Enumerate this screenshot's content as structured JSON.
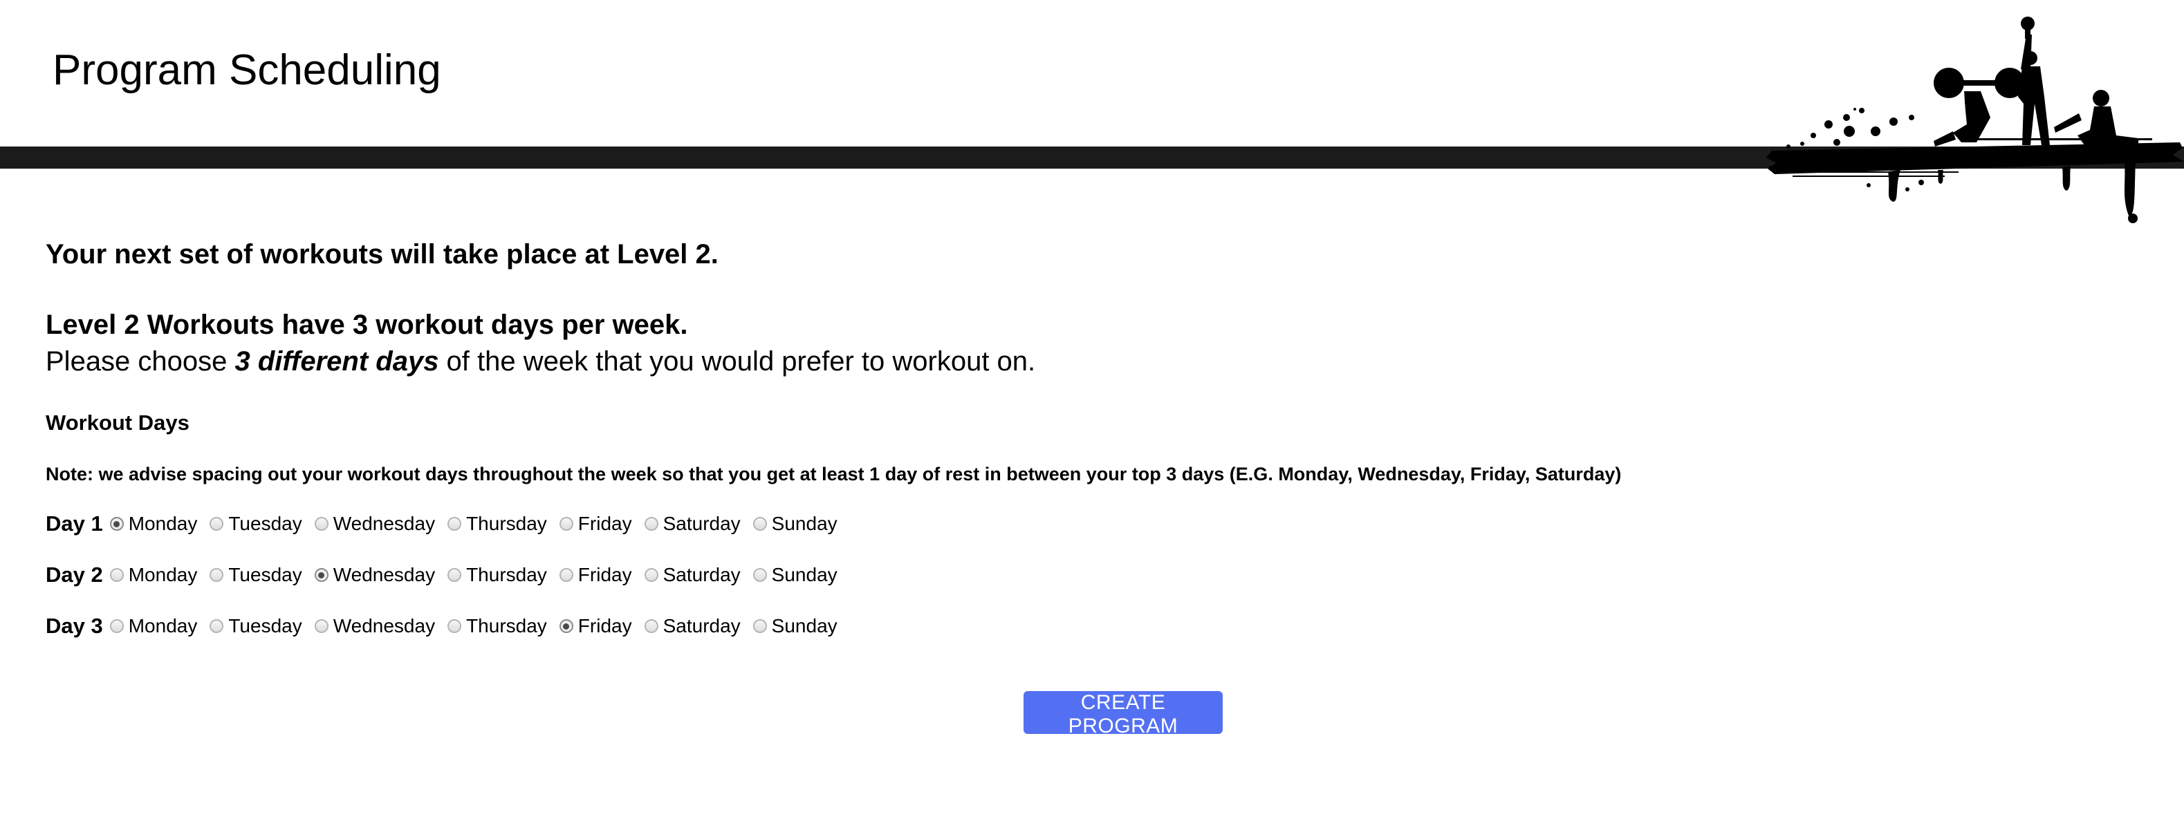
{
  "header": {
    "title": "Program Scheduling",
    "logo_icon": "fitness-athletes-silhouette-icon"
  },
  "intro": {
    "next_level_text": "Your next set of workouts will take place at Level 2.",
    "level_workouts_text": "Level 2 Workouts have 3 workout days per week.",
    "choose_prefix": "Please choose ",
    "choose_emphasis": "3 different days",
    "choose_suffix": " of the week that you would prefer to workout on."
  },
  "workout_days": {
    "label": "Workout Days",
    "note": "Note: we advise spacing out your workout days throughout the week so that you get at least 1 day of rest in between your top 3 days (E.G. Monday, Wednesday, Friday, Saturday)",
    "weekdays": [
      "Monday",
      "Tuesday",
      "Wednesday",
      "Thursday",
      "Friday",
      "Saturday",
      "Sunday"
    ],
    "days": [
      {
        "label": "Day 1",
        "selected": "Monday"
      },
      {
        "label": "Day 2",
        "selected": "Wednesday"
      },
      {
        "label": "Day 3",
        "selected": "Friday"
      }
    ]
  },
  "actions": {
    "create_label": "CREATE PROGRAM",
    "accent_color": "#5470f2"
  },
  "colors": {
    "header_bar": "#1b1b1b"
  }
}
